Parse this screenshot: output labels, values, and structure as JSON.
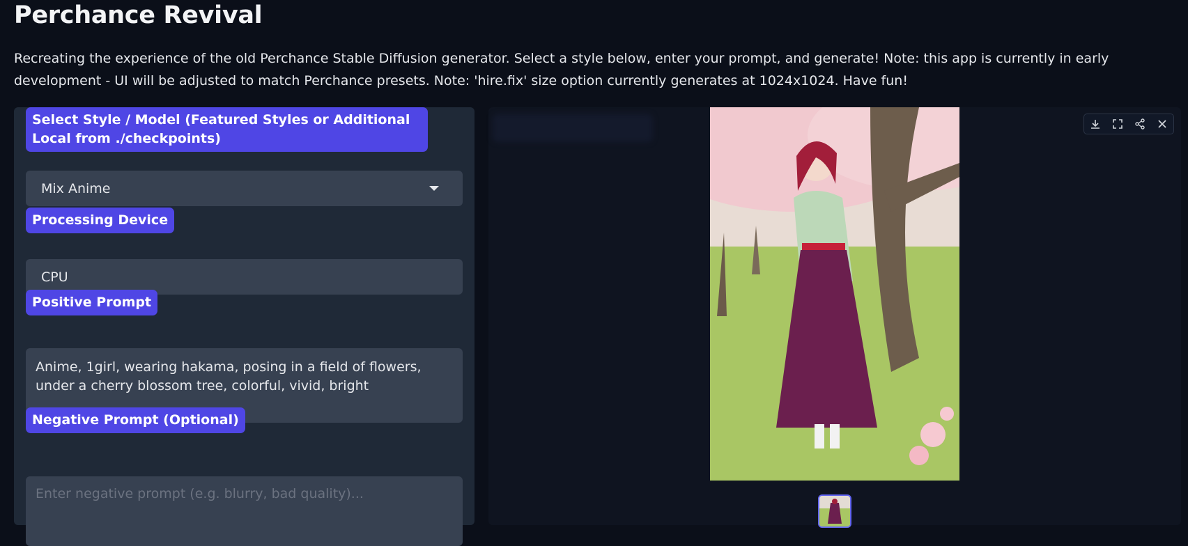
{
  "header": {
    "title": "Perchance Revival",
    "description": "Recreating the experience of the old Perchance Stable Diffusion generator. Select a style below, enter your prompt, and generate! Note: this app is currently in early development - UI will be adjusted to match Perchance presets. Note: 'hire.fix' size option currently generates at 1024x1024. Have fun!"
  },
  "form": {
    "style_label": "Select Style / Model (Featured Styles or Additional Local from ./checkpoints)",
    "style_value": "Mix Anime",
    "device_label": "Processing Device",
    "device_value": "CPU",
    "positive_label": "Positive Prompt",
    "positive_value": "Anime, 1girl, wearing hakama, posing in a field of flowers, under a cherry blossom tree, colorful, vivid, bright",
    "negative_label": "Negative Prompt (Optional)",
    "negative_placeholder": "Enter negative prompt (e.g. blurry, bad quality)..."
  },
  "gallery": {
    "toolbar": [
      "download-icon",
      "fullscreen-icon",
      "share-icon",
      "close-icon"
    ],
    "image_alt": "anime girl in hakama under cherry blossom tree"
  },
  "colors": {
    "accent": "#4f46e5",
    "background": "#0b0f19",
    "panel": "#1f2937",
    "field": "#374151"
  }
}
